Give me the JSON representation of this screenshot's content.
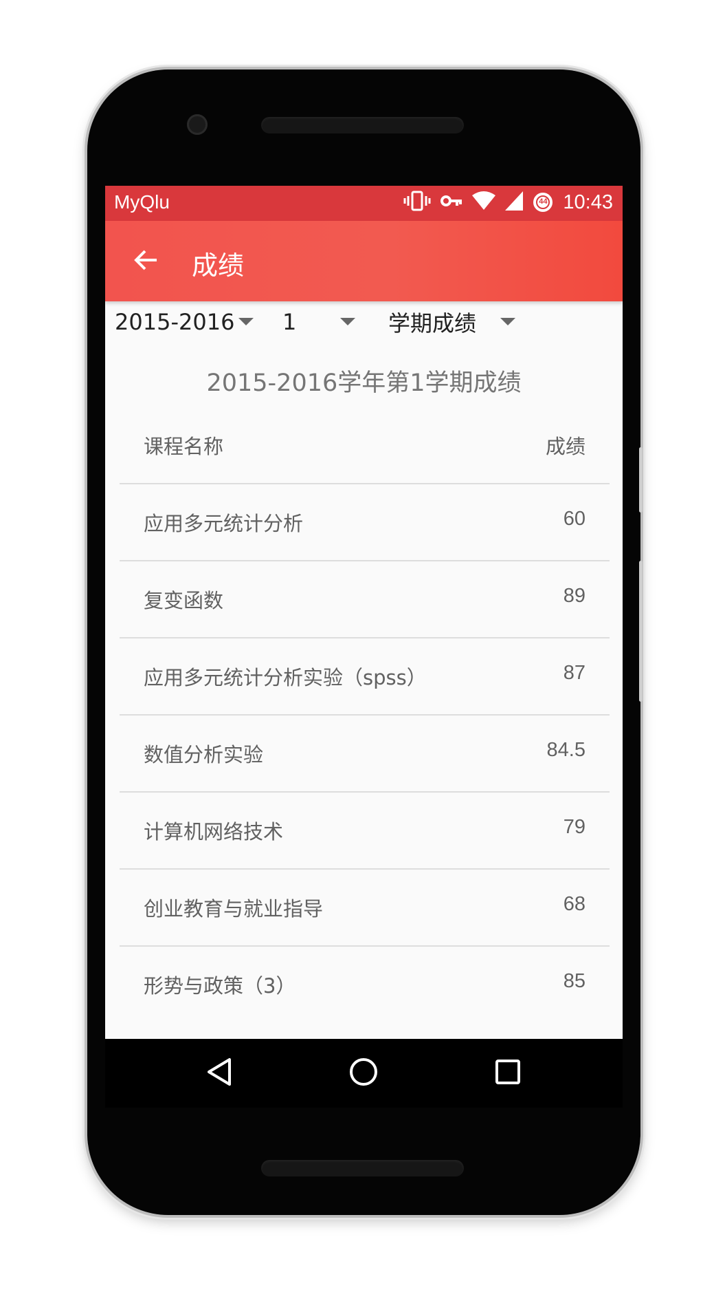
{
  "status_bar": {
    "app_name": "MyQlu",
    "time": "10:43",
    "battery_level": "44",
    "icons": [
      "vibrate-icon",
      "key-icon",
      "wifi-icon",
      "signal-icon",
      "battery-saver-icon"
    ]
  },
  "app_bar": {
    "title": "成绩",
    "back_icon": "arrow-left-icon"
  },
  "filters": {
    "year": "2015-2016",
    "term": "1",
    "type": "学期成绩"
  },
  "term_title": "2015-2016学年第1学期成绩",
  "table": {
    "headers": {
      "course": "课程名称",
      "score": "成绩"
    },
    "rows": [
      {
        "course": "应用多元统计分析",
        "score": "60"
      },
      {
        "course": "复变函数",
        "score": "89"
      },
      {
        "course": "应用多元统计分析实验（spss）",
        "score": "87"
      },
      {
        "course": "数值分析实验",
        "score": "84.5"
      },
      {
        "course": "计算机网络技术",
        "score": "79"
      },
      {
        "course": "创业教育与就业指导",
        "score": "68"
      },
      {
        "course": "形势与政策（3）",
        "score": "85"
      }
    ]
  },
  "nav_bar": {
    "icons": [
      "back-triangle-icon",
      "home-circle-icon",
      "recents-square-icon"
    ]
  },
  "colors": {
    "status_bar": "#d9383c",
    "app_bar": "#f2544e",
    "background": "#fafafa",
    "text_secondary": "#616161"
  }
}
